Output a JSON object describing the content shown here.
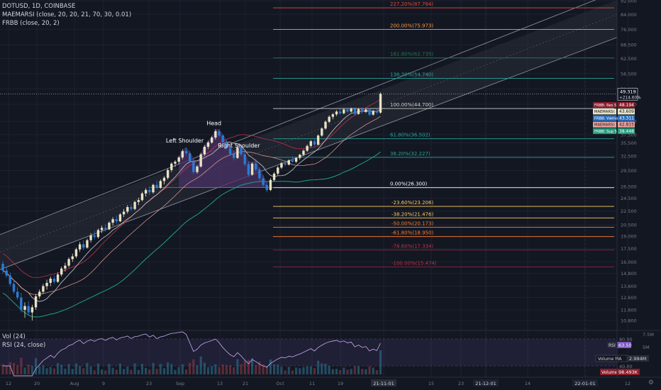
{
  "legend": {
    "symbol": "DOTUSD, 1D, COINBASE",
    "ind1": "MAEMARSI (close, 20, 20, 21, 70, 30, 0.01)",
    "ind2": "FRBB (close, 20, 2)",
    "vol": "Vol (24)",
    "rsi": "RSI (24, close)"
  },
  "colors": {
    "bg": "#131722",
    "up": "#e8e3c5",
    "down": "#2a7bd6",
    "axis": "#787b86",
    "grid": "#1e2230",
    "channel": "#2b2f3a",
    "fill": "#4a3366",
    "ma_red": "#c0304a",
    "ma_green": "#20a080",
    "ma_white": "#b8b8b8",
    "rsi": "#7e57c2"
  },
  "chart_data": {
    "type": "candlestick",
    "y_axis_scale": "log",
    "y_ticks": [
      "92.000",
      "84.000",
      "76.000",
      "68.500",
      "62.500",
      "56.500",
      "51.000",
      "46.000",
      "41.000",
      "37.500",
      "35.500",
      "32.500",
      "29.500",
      "26.500",
      "24.500",
      "22.500",
      "20.500",
      "19.000",
      "17.500",
      "16.000",
      "14.800",
      "13.600",
      "12.600",
      "11.600",
      "10.800"
    ],
    "x_ticks": [
      "12",
      "20",
      "Aug",
      "9",
      "23",
      "Sep",
      "13",
      "21",
      "Oct",
      "11",
      "19",
      "21-11-01",
      "15",
      "23",
      "21-12-01",
      "14",
      "22-01-01",
      "12"
    ],
    "fib_levels": [
      {
        "label": "227.20%(87.764)",
        "value": 87.764,
        "color": "#e04b3c"
      },
      {
        "label": "200.00%(75.973)",
        "value": 75.973,
        "color": "#ff9a3c"
      },
      {
        "label": "161.80%(62.735)",
        "value": 62.735,
        "color": "#1f7a4d"
      },
      {
        "label": "138.20%(54.740)",
        "value": 54.74,
        "color": "#26a69a"
      },
      {
        "label": "100.00%(44.700)",
        "value": 44.7,
        "color": "#cfcfcf"
      },
      {
        "label": "61.80%(36.502)",
        "value": 36.502,
        "color": "#26a69a"
      },
      {
        "label": "38.20%(32.227)",
        "value": 32.227,
        "color": "#26a69a"
      },
      {
        "label": "0.00%(26.300)",
        "value": 26.3,
        "color": "#ffffff"
      },
      {
        "label": "-23.60%(23.206)",
        "value": 23.206,
        "color": "#ffcc66"
      },
      {
        "label": "-38.20%(21.476)",
        "value": 21.476,
        "color": "#ffcc66"
      },
      {
        "label": "-50.00%(20.173)",
        "value": 20.173,
        "color": "#ff7b2e"
      },
      {
        "label": "-61.80%(18.950)",
        "value": 18.95,
        "color": "#ff7b2e"
      },
      {
        "label": "-78.60%(17.334)",
        "value": 17.334,
        "color": "#c0304a"
      },
      {
        "label": "-100.00%(15.474)",
        "value": 15.474,
        "color": "#c0304a"
      }
    ],
    "annotations": [
      "Left Shoulder",
      "Head",
      "Right Shoulder"
    ],
    "price_labels": [
      {
        "text": "49.319",
        "sub": "+214.60%",
        "value": 49.319,
        "color": "#ffffff",
        "textcolor": "#131722"
      },
      {
        "text": "FRBB: Res 5",
        "value": 48.194,
        "price": "48.194",
        "color": "#8b1d2c",
        "textcolor": "#ffffff"
      },
      {
        "text": "MAEMARSI: SMA",
        "value": 43.609,
        "price": "43.609",
        "color": "#e8e3c5",
        "textcolor": "#131722"
      },
      {
        "text": "FRBB: Vwma",
        "value": 43.311,
        "price": "43.311",
        "color": "#2a6fbf",
        "textcolor": "#ffffff"
      },
      {
        "text": "MAEMARSI: EMA",
        "value": 42.815,
        "price": "42.815",
        "color": "#e6a09a",
        "textcolor": "#131722"
      },
      {
        "text": "FRBB: Sup 5",
        "value": 38.448,
        "price": "38.448",
        "color": "#1f9e7a",
        "textcolor": "#ffffff"
      }
    ],
    "sub_y_ticks": [
      "80.00",
      "40.00"
    ],
    "rsi_value": "63.50",
    "volume_ma": "Volume MA",
    "volume_ma_value": "2.994M",
    "volume": "Volume",
    "volume_value": "98.493K",
    "vol_scale": [
      "7.5M",
      "5M"
    ],
    "candles": [
      [
        15.8,
        16.1,
        14.8,
        15.1
      ],
      [
        15.1,
        15.5,
        14.4,
        14.6
      ],
      [
        14.6,
        14.9,
        13.6,
        13.8
      ],
      [
        13.8,
        14.2,
        12.9,
        13.1
      ],
      [
        13.1,
        13.5,
        12.4,
        12.6
      ],
      [
        12.6,
        13.0,
        11.4,
        11.6
      ],
      [
        11.6,
        12.2,
        11.0,
        11.9
      ],
      [
        11.9,
        12.3,
        11.2,
        11.4
      ],
      [
        11.4,
        12.0,
        10.8,
        11.8
      ],
      [
        11.8,
        12.9,
        11.6,
        12.7
      ],
      [
        12.7,
        13.3,
        12.5,
        13.1
      ],
      [
        13.1,
        13.8,
        12.9,
        13.6
      ],
      [
        13.6,
        14.2,
        13.3,
        13.9
      ],
      [
        13.9,
        14.5,
        13.6,
        14.3
      ],
      [
        14.3,
        14.6,
        13.8,
        14.0
      ],
      [
        14.0,
        14.9,
        13.9,
        14.7
      ],
      [
        14.7,
        15.5,
        14.5,
        15.3
      ],
      [
        15.3,
        15.9,
        15.0,
        15.6
      ],
      [
        15.6,
        16.5,
        15.4,
        16.3
      ],
      [
        16.3,
        16.9,
        16.0,
        16.6
      ],
      [
        16.6,
        17.6,
        16.4,
        17.4
      ],
      [
        17.4,
        18.3,
        17.1,
        18.0
      ],
      [
        18.0,
        18.5,
        17.3,
        17.6
      ],
      [
        17.6,
        18.7,
        17.5,
        18.5
      ],
      [
        18.5,
        19.4,
        18.2,
        19.1
      ],
      [
        19.1,
        19.7,
        18.6,
        18.9
      ],
      [
        18.9,
        20.0,
        18.7,
        19.8
      ],
      [
        19.8,
        20.4,
        19.4,
        20.1
      ],
      [
        20.1,
        20.6,
        19.6,
        19.9
      ],
      [
        19.9,
        21.0,
        19.8,
        20.8
      ],
      [
        20.8,
        21.6,
        20.4,
        21.3
      ],
      [
        21.3,
        21.8,
        20.7,
        21.0
      ],
      [
        21.0,
        22.2,
        20.9,
        22.0
      ],
      [
        22.0,
        22.8,
        21.6,
        22.4
      ],
      [
        22.4,
        23.4,
        22.1,
        23.1
      ],
      [
        23.1,
        23.6,
        22.5,
        22.8
      ],
      [
        22.8,
        24.1,
        22.6,
        23.9
      ],
      [
        23.9,
        24.6,
        23.4,
        24.2
      ],
      [
        24.2,
        25.6,
        24.0,
        25.3
      ],
      [
        25.3,
        26.2,
        24.8,
        25.9
      ],
      [
        25.9,
        26.5,
        25.1,
        25.5
      ],
      [
        25.5,
        27.0,
        25.3,
        26.8
      ],
      [
        26.8,
        27.6,
        26.0,
        26.3
      ],
      [
        26.3,
        27.8,
        26.1,
        27.5
      ],
      [
        27.5,
        28.4,
        26.9,
        28.1
      ],
      [
        28.1,
        29.9,
        27.8,
        29.6
      ],
      [
        29.6,
        31.2,
        29.2,
        30.9
      ],
      [
        30.9,
        31.6,
        30.2,
        31.3
      ],
      [
        31.3,
        32.5,
        30.8,
        32.2
      ],
      [
        32.2,
        34.0,
        31.8,
        33.6
      ],
      [
        33.6,
        34.5,
        32.7,
        33.1
      ],
      [
        33.1,
        33.5,
        31.0,
        31.4
      ],
      [
        31.4,
        32.0,
        28.8,
        29.2
      ],
      [
        29.2,
        30.6,
        28.9,
        30.3
      ],
      [
        30.3,
        33.2,
        30.1,
        32.9
      ],
      [
        32.9,
        35.0,
        32.6,
        34.6
      ],
      [
        34.6,
        36.0,
        34.1,
        35.6
      ],
      [
        35.6,
        37.2,
        35.3,
        36.8
      ],
      [
        36.8,
        38.9,
        36.3,
        38.4
      ],
      [
        38.4,
        38.9,
        36.9,
        37.3
      ],
      [
        37.3,
        37.6,
        35.3,
        35.7
      ],
      [
        35.7,
        36.2,
        33.9,
        34.3
      ],
      [
        34.3,
        34.9,
        32.5,
        33.0
      ],
      [
        33.0,
        33.6,
        31.6,
        32.1
      ],
      [
        32.1,
        34.8,
        31.9,
        34.4
      ],
      [
        34.4,
        35.0,
        32.5,
        32.9
      ],
      [
        32.9,
        33.4,
        30.4,
        30.8
      ],
      [
        30.8,
        31.4,
        28.3,
        28.7
      ],
      [
        28.7,
        31.2,
        28.5,
        30.9
      ],
      [
        30.9,
        31.8,
        29.3,
        29.7
      ],
      [
        29.7,
        30.1,
        27.6,
        28.0
      ],
      [
        28.0,
        28.6,
        26.4,
        26.8
      ],
      [
        26.8,
        27.3,
        25.5,
        25.9
      ],
      [
        25.9,
        28.0,
        25.7,
        27.7
      ],
      [
        27.7,
        29.2,
        27.4,
        28.9
      ],
      [
        28.9,
        30.4,
        28.6,
        30.1
      ],
      [
        30.1,
        31.3,
        29.8,
        31.0
      ],
      [
        31.0,
        31.6,
        30.4,
        30.7
      ],
      [
        30.7,
        31.8,
        30.5,
        31.6
      ],
      [
        31.6,
        32.5,
        31.1,
        31.3
      ],
      [
        31.3,
        32.3,
        31.0,
        32.1
      ],
      [
        32.1,
        33.0,
        31.7,
        32.8
      ],
      [
        32.8,
        34.0,
        32.5,
        33.7
      ],
      [
        33.7,
        35.1,
        33.4,
        34.8
      ],
      [
        34.8,
        36.2,
        34.5,
        35.9
      ],
      [
        35.9,
        36.4,
        34.7,
        35.1
      ],
      [
        35.1,
        37.6,
        34.9,
        37.3
      ],
      [
        37.3,
        39.4,
        37.0,
        39.1
      ],
      [
        39.1,
        41.3,
        38.8,
        40.9
      ],
      [
        40.9,
        42.7,
        40.5,
        42.3
      ],
      [
        42.3,
        43.4,
        41.6,
        43.0
      ],
      [
        43.0,
        44.2,
        42.5,
        43.8
      ],
      [
        43.8,
        44.5,
        42.9,
        43.3
      ],
      [
        43.3,
        44.8,
        43.0,
        44.4
      ],
      [
        44.4,
        44.9,
        43.4,
        43.8
      ],
      [
        43.8,
        45.0,
        43.5,
        44.6
      ],
      [
        44.6,
        45.1,
        42.7,
        43.1
      ],
      [
        43.1,
        44.9,
        42.9,
        44.5
      ],
      [
        44.5,
        45.0,
        43.3,
        43.7
      ],
      [
        43.7,
        44.8,
        43.4,
        44.4
      ],
      [
        44.4,
        44.9,
        42.5,
        42.9
      ],
      [
        42.9,
        44.3,
        42.6,
        44.0
      ],
      [
        44.0,
        44.6,
        43.0,
        43.5
      ],
      [
        43.5,
        49.8,
        43.2,
        49.3
      ]
    ]
  }
}
